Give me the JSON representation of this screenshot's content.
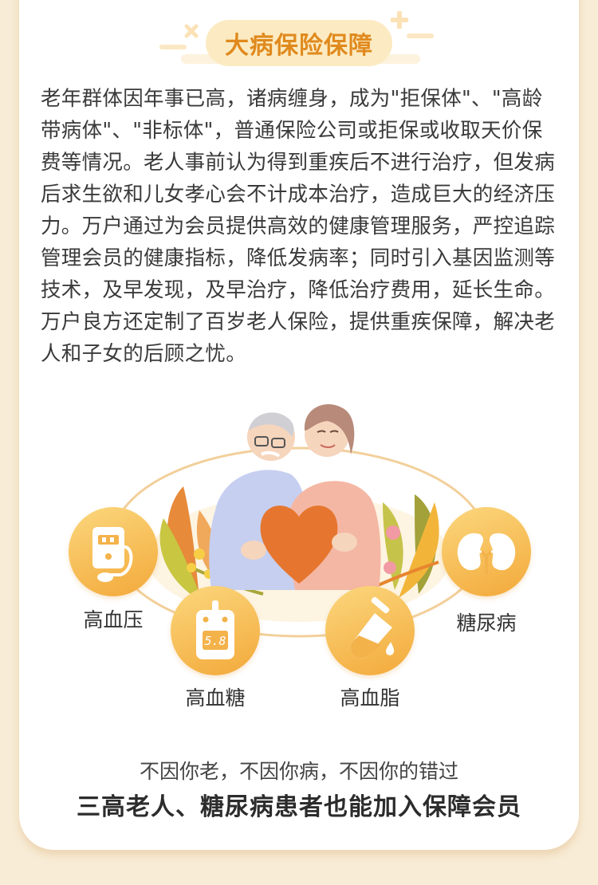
{
  "section": {
    "title": "大病保险保障",
    "intro": "老年群体因年事已高，诸病缠身，成为\"拒保体\"、\"高龄带病体\"、\"非标体\"，普通保险公司或拒保或收取天价保费等情况。老人事前认为得到重疾后不进行治疗，但发病后求生欲和儿女孝心会不计成本治疗，造成巨大的经济压力。万户通过为会员提供高效的健康管理服务，严控追踪管理会员的健康指标，降低发病率；同时引入基因监测等技术，及早发现，及早治疗，降低治疗费用，延长生命。万户良方还定制了百岁老人保险，提供重疾保障，解决老人和子女的后顾之忧。"
  },
  "conditions": [
    {
      "label": "高血压",
      "icon": "blood-pressure-monitor-icon"
    },
    {
      "label": "高血糖",
      "icon": "glucose-meter-icon",
      "reading": "5.8"
    },
    {
      "label": "高血脂",
      "icon": "test-tube-icon"
    },
    {
      "label": "糖尿病",
      "icon": "kidney-icon"
    }
  ],
  "tagline": {
    "line1": "不因你老，不因你病，不因你的错过",
    "line2": "三高老人、糖尿病患者也能加入保障会员"
  },
  "colors": {
    "accent": "#e08a1e",
    "pill": "#fcebc2",
    "icon_gradient_top": "#fbd77d",
    "icon_gradient_bottom": "#f3a93a",
    "heart": "#e6762f",
    "background": "#f8ecd6"
  }
}
